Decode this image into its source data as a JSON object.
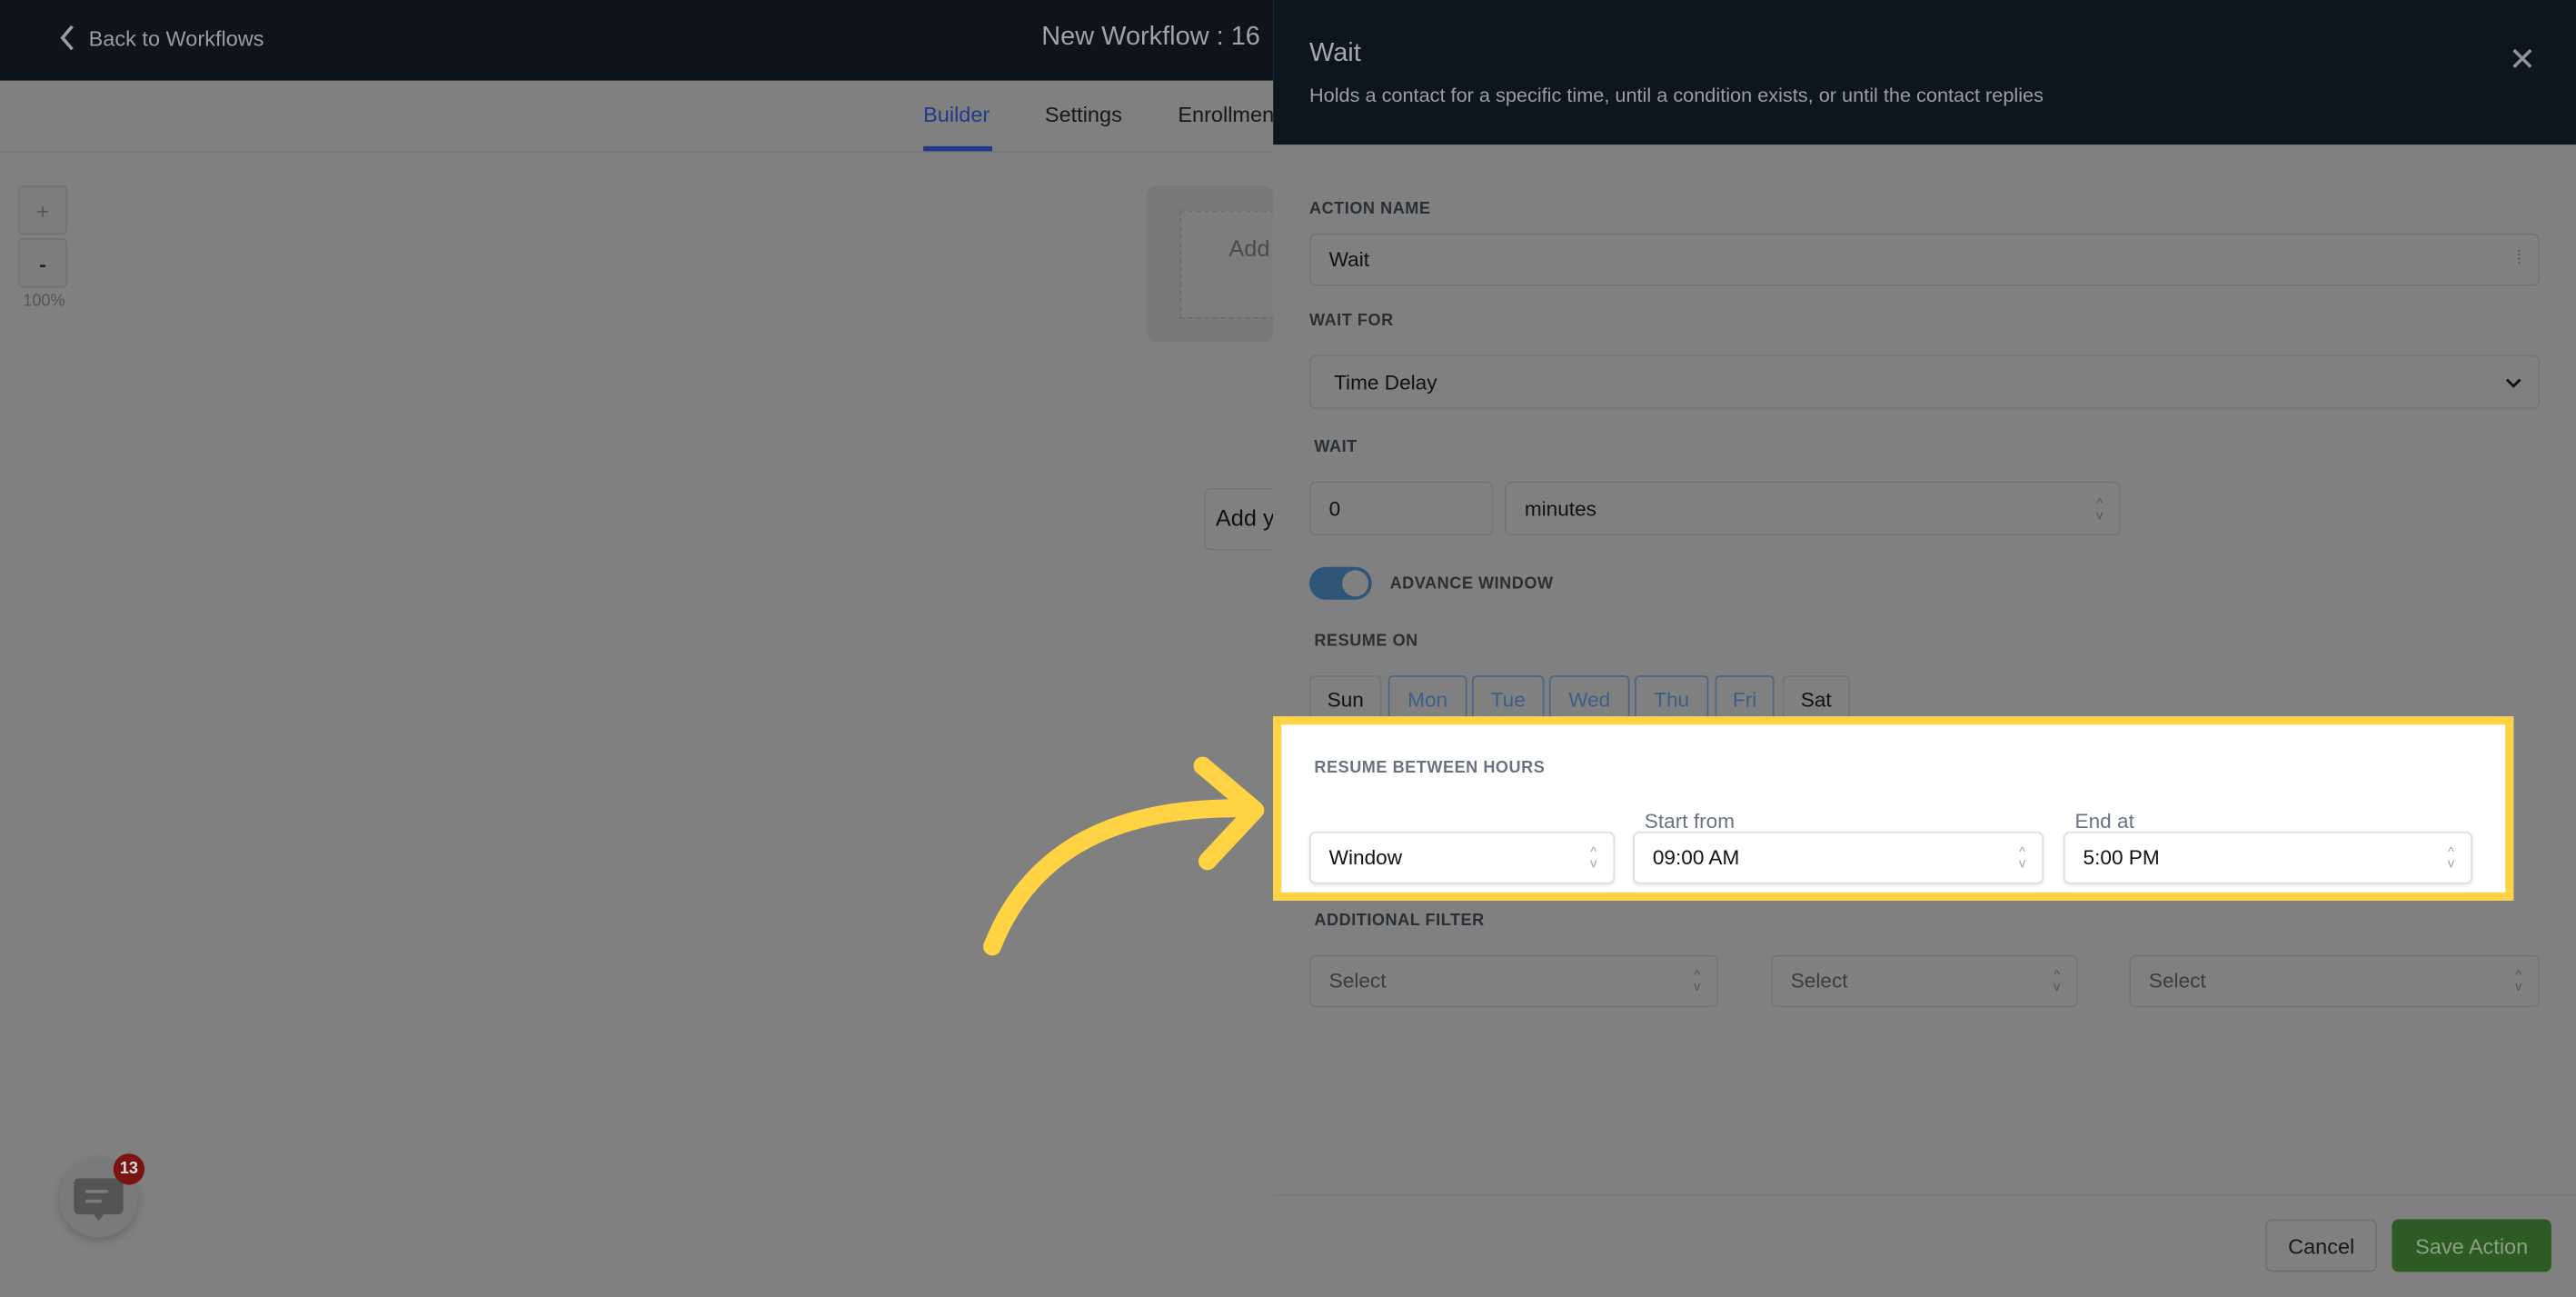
{
  "header": {
    "back_label": "Back to Workflows",
    "workflow_title": "New Workflow : 16"
  },
  "tabs": [
    {
      "label": "Builder",
      "active": true
    },
    {
      "label": "Settings"
    },
    {
      "label": "Enrollment"
    }
  ],
  "canvas": {
    "zoom_in": "+",
    "zoom_out": "-",
    "zoom_level": "100%",
    "trigger_card_text": "Add",
    "add_action_text": "Add your"
  },
  "panel": {
    "title": "Wait",
    "subtitle": "Holds a contact for a specific time, until a condition exists, or until the contact replies",
    "action_name_label": "ACTION NAME",
    "action_name_value": "Wait",
    "wait_for_label": "WAIT FOR",
    "wait_for_value": "Time Delay",
    "wait_label": "WAIT",
    "wait_amount": "0",
    "wait_unit": "minutes",
    "advance_window_label": "ADVANCE WINDOW",
    "advance_window_on": true,
    "resume_on_label": "RESUME ON",
    "days": [
      {
        "label": "Sun",
        "selected": false
      },
      {
        "label": "Mon",
        "selected": true
      },
      {
        "label": "Tue",
        "selected": true
      },
      {
        "label": "Wed",
        "selected": true
      },
      {
        "label": "Thu",
        "selected": true
      },
      {
        "label": "Fri",
        "selected": true
      },
      {
        "label": "Sat",
        "selected": false
      }
    ],
    "resume_hours_label": "RESUME BETWEEN HOURS",
    "resume_mode": "Window",
    "start_label": "Start from",
    "start_value": "09:00 AM",
    "end_label": "End at",
    "end_value": "5:00 PM",
    "additional_filter_label": "ADDITIONAL FILTER",
    "filters": [
      "Select",
      "Select",
      "Select"
    ],
    "cancel_label": "Cancel",
    "save_label": "Save Action"
  },
  "chat_widget": {
    "badge_count": "13"
  },
  "colors": {
    "highlight": "#ffd343",
    "accent_blue": "#23398a",
    "save_green": "#2e5a24",
    "badge_red": "#7a1410"
  }
}
